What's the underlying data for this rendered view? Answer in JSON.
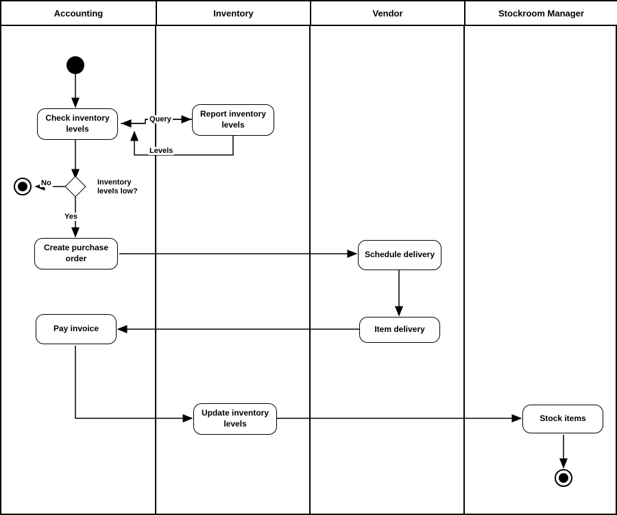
{
  "lanes": {
    "accounting": "Accounting",
    "inventory": "Inventory",
    "vendor": "Vendor",
    "stockroom": "Stockroom Manager"
  },
  "activities": {
    "check_inventory": "Check inventory levels",
    "report_inventory": "Report inventory levels",
    "create_po": "Create purchase order",
    "schedule_delivery": "Schedule delivery",
    "item_delivery": "Item delivery",
    "pay_invoice": "Pay invoice",
    "update_inventory": "Update inventory levels",
    "stock_items": "Stock items"
  },
  "labels": {
    "query": "Query",
    "levels": "Levels",
    "decision_text": "Inventory levels low?",
    "yes": "Yes",
    "no": "No"
  }
}
